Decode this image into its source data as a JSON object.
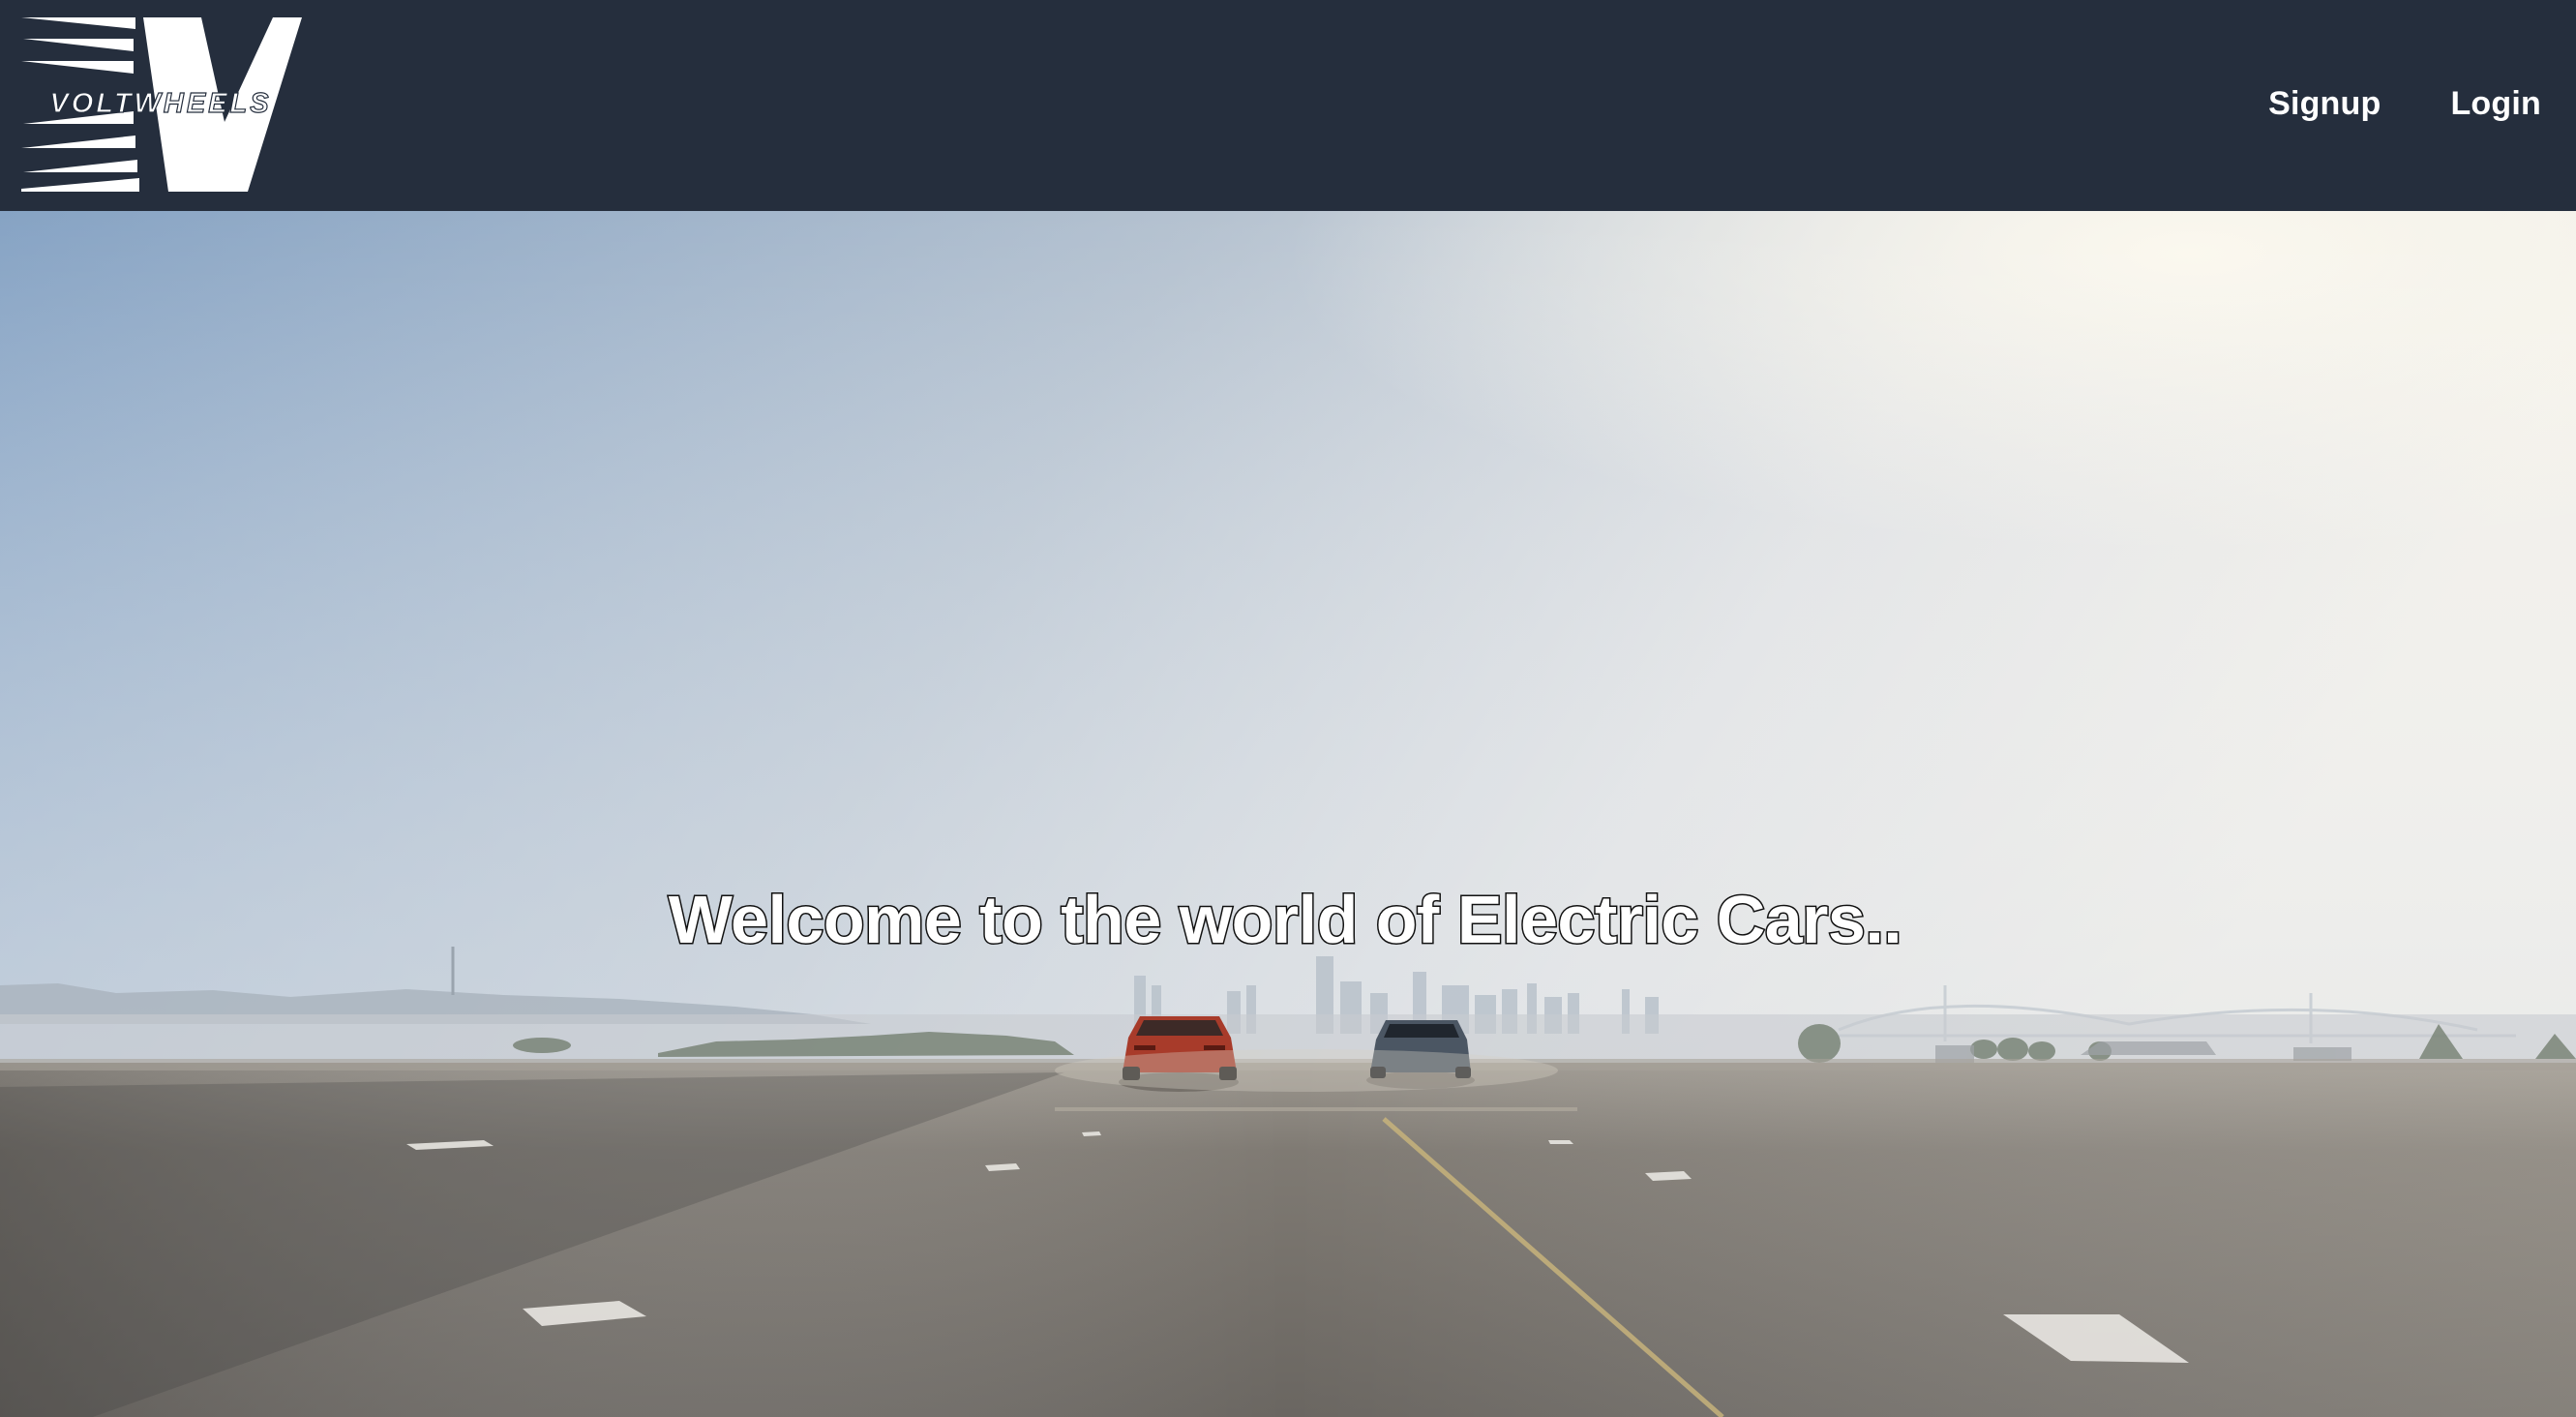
{
  "brand": {
    "logo_text": "VOLTWHEELS",
    "logo_icon": "voltwheels-v-logo"
  },
  "nav": {
    "signup_label": "Signup",
    "login_label": "Login"
  },
  "hero": {
    "headline": "Welcome to the world of Electric Cars..",
    "background": "video-still-two-cars-on-runway"
  },
  "colors": {
    "navbar_bg": "#252e3d",
    "nav_text": "#ffffff",
    "sky_top": "#8fa9c6",
    "road": "#6f6b66"
  }
}
